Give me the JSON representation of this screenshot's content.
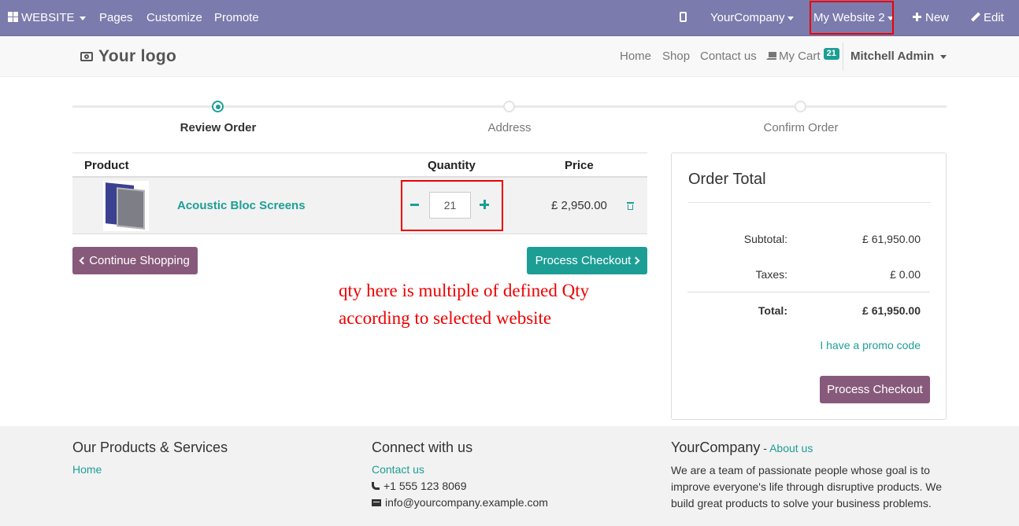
{
  "adminbar": {
    "website_label": "WEBSITE",
    "pages": "Pages",
    "customize": "Customize",
    "promote": "Promote",
    "company": "YourCompany",
    "website_switcher": "My Website 2",
    "new_label": "New",
    "edit_label": "Edit",
    "bg_color": "#7c7bad"
  },
  "header": {
    "logo": "Your logo",
    "nav": {
      "home": "Home",
      "shop": "Shop",
      "contact": "Contact us",
      "cart": "My Cart",
      "cart_count": "21",
      "user": "Mitchell Admin"
    }
  },
  "wizard": {
    "steps": [
      {
        "label": "Review Order",
        "active": true
      },
      {
        "label": "Address",
        "active": false
      },
      {
        "label": "Confirm Order",
        "active": false
      }
    ]
  },
  "cart": {
    "columns": {
      "product": "Product",
      "quantity": "Quantity",
      "price": "Price"
    },
    "lines": [
      {
        "name": "Acoustic Bloc Screens",
        "qty": "21",
        "price": "£ 2,950.00"
      }
    ],
    "continue_label": "Continue Shopping",
    "checkout_label": "Process Checkout"
  },
  "annotation": "qty here is multiple of defined Qty according to selected website",
  "order_total": {
    "title": "Order Total",
    "subtotal_label": "Subtotal:",
    "subtotal_value": "£ 61,950.00",
    "taxes_label": "Taxes:",
    "taxes_value": "£ 0.00",
    "total_label": "Total:",
    "total_value": "£ 61,950.00",
    "promo": "I have a promo code",
    "checkout_label": "Process Checkout"
  },
  "footer": {
    "col1": {
      "title": "Our Products & Services",
      "link": "Home"
    },
    "col2": {
      "title": "Connect with us",
      "contact": "Contact us",
      "phone": "+1 555 123 8069",
      "email": "info@yourcompany.example.com"
    },
    "col3": {
      "title": "YourCompany",
      "title_sep": " - ",
      "about": "About us",
      "text": "We are a team of passionate people whose goal is to improve everyone's life through disruptive products. We build great products to solve your business problems."
    }
  },
  "colors": {
    "accent": "#1d9e95",
    "primary": "#875a7b",
    "highlight": "#ee0000"
  }
}
